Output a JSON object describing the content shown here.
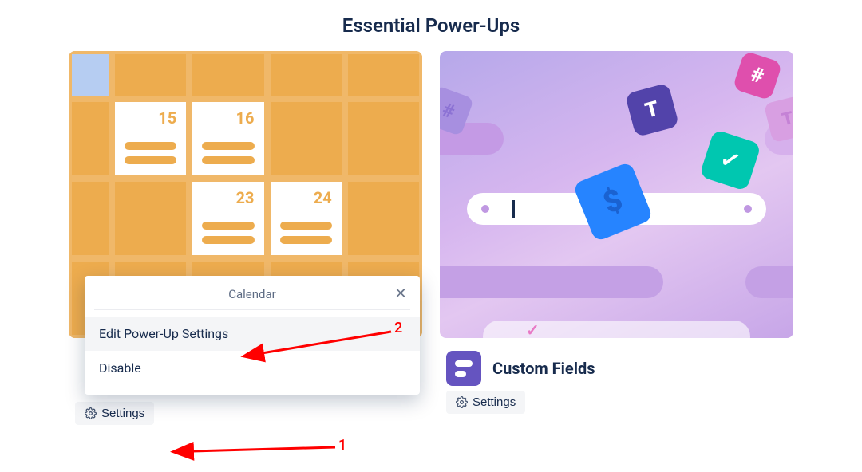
{
  "header": {
    "title": "Essential Power-Ups"
  },
  "cards": {
    "calendar": {
      "cells": [
        {
          "date": "15"
        },
        {
          "date": "16"
        },
        {
          "date": "23"
        },
        {
          "date": "24"
        }
      ],
      "settings_label": "Settings"
    },
    "custom_fields": {
      "name": "Custom Fields",
      "icon_color": "#6554c0",
      "settings_label": "Settings"
    }
  },
  "popup": {
    "title": "Calendar",
    "items": [
      {
        "label": "Edit Power-Up Settings",
        "hover": true
      },
      {
        "label": "Disable",
        "hover": false
      }
    ]
  },
  "annotations": {
    "arrow1_label": "1",
    "arrow2_label": "2"
  }
}
